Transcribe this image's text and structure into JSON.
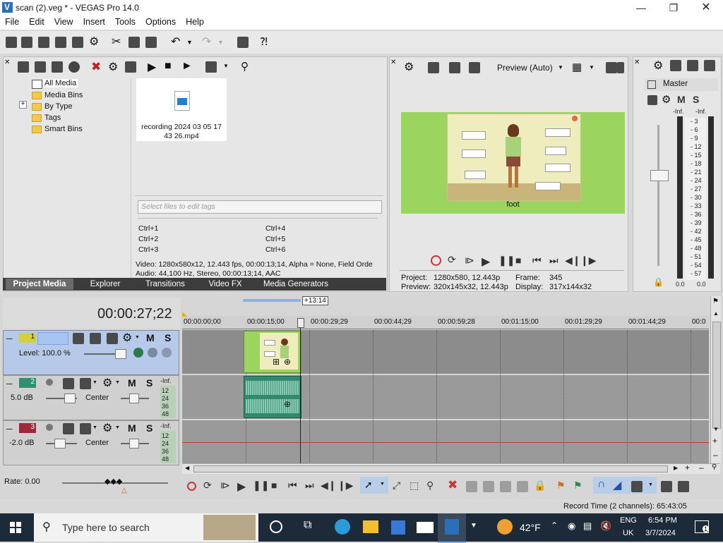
{
  "window": {
    "title": "scan (2).veg * - VEGAS Pro 14.0"
  },
  "menu": [
    "File",
    "Edit",
    "View",
    "Insert",
    "Tools",
    "Options",
    "Help"
  ],
  "media_tree": {
    "items": [
      "All Media",
      "Media Bins",
      "By Type",
      "Tags",
      "Smart Bins"
    ],
    "expander": "+"
  },
  "media_file": {
    "name": "recording 2024 03 05 17 43 26.mp4"
  },
  "tags": {
    "placeholder": "Select files to edit tags",
    "shortcuts": [
      "Ctrl+1",
      "Ctrl+2",
      "Ctrl+3",
      "Ctrl+4",
      "Ctrl+5",
      "Ctrl+6"
    ]
  },
  "media_info": {
    "video": "Video: 1280x580x12, 12.443 fps, 00:00:13;14, Alpha = None, Field Orde",
    "audio": "Audio: 44,100 Hz, Stereo, 00:00:13;14, AAC"
  },
  "tabs": [
    "Project Media",
    "Explorer",
    "Transitions",
    "Video FX",
    "Media Generators"
  ],
  "preview": {
    "mode": "Preview (Auto)",
    "caption": "foot",
    "project_label": "Project:",
    "project_value": "1280x580, 12.443p",
    "preview_label": "Preview:",
    "preview_value": "320x145x32, 12.443p",
    "frame_label": "Frame:",
    "frame_value": "345",
    "display_label": "Display:",
    "display_value": "317x144x32"
  },
  "master": {
    "label": "Master",
    "m": "M",
    "s": "S",
    "inf_left": "-Inf.",
    "inf_right": "-Inf.",
    "scale": [
      "3",
      "6",
      "9",
      "12",
      "15",
      "18",
      "21",
      "24",
      "27",
      "30",
      "33",
      "36",
      "39",
      "42",
      "45",
      "48",
      "51",
      "54",
      "57"
    ],
    "val_left": "0.0",
    "val_right": "0.0"
  },
  "timeline": {
    "timecode": "00:00:27;22",
    "length_badge": "+13:14",
    "ruler": [
      "00:00:00;00",
      "00:00:15;00",
      "00:00:29;29",
      "00:00:44;29",
      "00:00:59;28",
      "00:01:15;00",
      "00:01:29;29",
      "00:01:44;29",
      "00:0"
    ],
    "rate": "Rate: 0.00",
    "record_time": "Record Time (2 channels): 65:43:05"
  },
  "tracks": [
    {
      "num": "1",
      "m": "M",
      "s": "S",
      "level": "Level: 100.0 %",
      "color": "#d4d03c"
    },
    {
      "num": "2",
      "m": "M",
      "s": "S",
      "vol": "5.0 dB",
      "pan": "Center",
      "inf": "-Inf.",
      "meter": [
        "12",
        "24",
        "36",
        "48"
      ],
      "color": "#2f8f6f"
    },
    {
      "num": "3",
      "m": "M",
      "s": "S",
      "vol": "-2.0 dB",
      "pan": "Center",
      "inf": "-Inf.",
      "meter": [
        "12",
        "24",
        "36",
        "48"
      ],
      "color": "#a02838"
    }
  ],
  "taskbar": {
    "search_placeholder": "Type here to search",
    "weather": "42°F",
    "lang1": "ENG",
    "lang2": "UK",
    "time": "6:54 PM",
    "date": "3/7/2024",
    "notif_count": "1"
  }
}
